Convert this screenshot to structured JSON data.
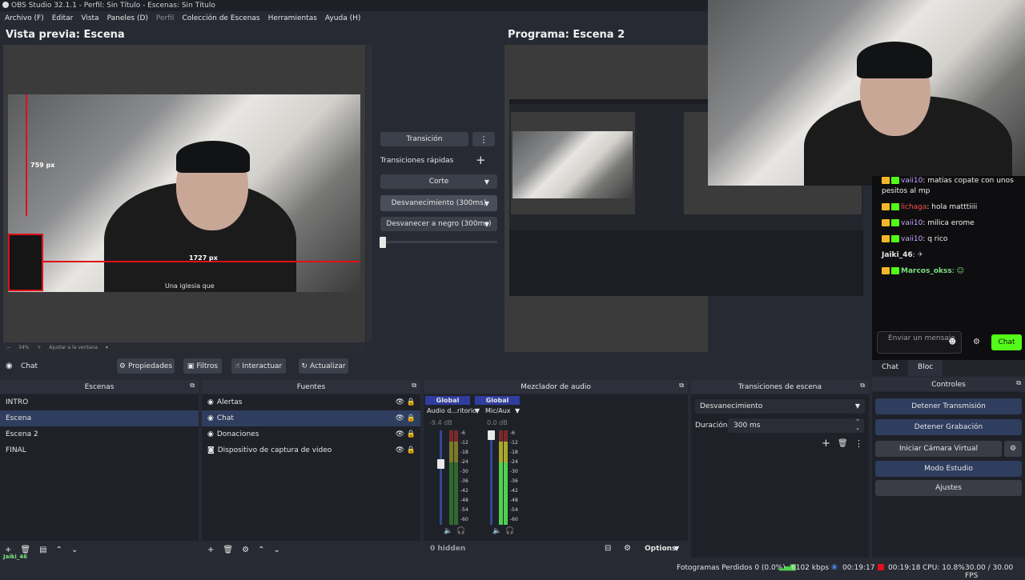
{
  "window": {
    "title": "OBS Studio 32.1.1 - Perfil: Sin Título - Escenas: Sin Título"
  },
  "menu": [
    {
      "label": "Archivo (F)",
      "enabled": true
    },
    {
      "label": "Editar",
      "enabled": true
    },
    {
      "label": "Vista",
      "enabled": true
    },
    {
      "label": "Paneles (D)",
      "enabled": true
    },
    {
      "label": "Perfil",
      "enabled": false
    },
    {
      "label": "Colección de Escenas",
      "enabled": true
    },
    {
      "label": "Herramientas",
      "enabled": true
    },
    {
      "label": "Ayuda (H)",
      "enabled": true
    }
  ],
  "preview": {
    "title": "Vista previa: Escena",
    "measure_v": "759 px",
    "measure_h": "1727 px",
    "zoom": "34%",
    "fit_label": "Ajustar a la ventana",
    "shirt_text": "Una iglesia que"
  },
  "program": {
    "title": "Programa: Escena 2"
  },
  "transitions_center": {
    "transition_label": "Transición",
    "quick_label": "Transiciones rápidas",
    "cut_label": "Corte",
    "fade_label": "Desvanecimiento (300ms)",
    "fade_black_label": "Desvanecer a negro (300ms)"
  },
  "source_toolbar": {
    "selected_source": "Chat",
    "properties": "Propiedades",
    "filters": "Filtros",
    "interact": "Interactuar",
    "refresh": "Actualizar"
  },
  "scenes": {
    "title": "Escenas",
    "items": [
      "INTRO",
      "Escena",
      "Escena 2",
      "FINAL"
    ],
    "selected": "Escena"
  },
  "sources": {
    "title": "Fuentes",
    "items": [
      {
        "label": "Alertas",
        "icon": "globe-icon"
      },
      {
        "label": "Chat",
        "icon": "globe-icon"
      },
      {
        "label": "Donaciones",
        "icon": "globe-icon"
      },
      {
        "label": "Dispositivo de captura de video",
        "icon": "camera-icon"
      }
    ],
    "selected": "Chat"
  },
  "mixer": {
    "title": "Mezclador de audio",
    "channels": [
      {
        "tag": "Global",
        "name": "Audio d...ritorio",
        "db": "-9.4 dB",
        "level": 0.0
      },
      {
        "tag": "Global",
        "name": "Mic/Aux",
        "db": "0.0 dB",
        "level": 0.78
      }
    ],
    "scale": [
      "-6",
      "-12",
      "-18",
      "-24",
      "-30",
      "-36",
      "-42",
      "-48",
      "-54",
      "-60"
    ],
    "hidden": "0 hidden",
    "options": "Options"
  },
  "scene_transitions": {
    "title": "Transiciones de escena",
    "type": "Desvanecimiento",
    "duration_label": "Duración",
    "duration_value": "300 ms"
  },
  "controls": {
    "title": "Controles",
    "stop_stream": "Detener Transmisión",
    "stop_record": "Detener Grabación",
    "virtual_cam": "Iniciar Cámara Virtual",
    "studio_mode": "Modo Estudio",
    "settings": "Ajustes"
  },
  "chat": {
    "messages": [
      {
        "user": "vaii10",
        "text": ": matias copate con unos pesitos al mp",
        "color": "#c8a6ff"
      },
      {
        "user": "lichaga",
        "text": ": hola matttiiii",
        "color": "#ff4d4d"
      },
      {
        "user": "vaii10",
        "text": ": milica erome",
        "color": "#c8a6ff"
      },
      {
        "user": "vaii10",
        "text": ": q rico",
        "color": "#c8a6ff"
      },
      {
        "user": "Jaiki_46",
        "text": ":",
        "color": "#e6e6e6"
      },
      {
        "user": "Marcos_okss",
        "text": ":",
        "color": "#7ee081"
      }
    ],
    "input_placeholder": "Enviar un mensaje",
    "send": "Chat",
    "tabs": [
      "Chat",
      "Bloc"
    ]
  },
  "statusbar": {
    "frames_dropped": "Fotogramas Perdidos 0 (0.0%)",
    "bitrate": "6102 kbps",
    "stream_time": "00:19:17",
    "rec_time": "00:19:18",
    "cpu": "CPU: 10.8%",
    "fps": "30.00 / 30.00 FPS"
  },
  "corner_user": "Jaiki_46",
  "colors": {
    "accent": "#2f3d5e",
    "live": "#53fc18",
    "red_guide": "#e0101a"
  }
}
